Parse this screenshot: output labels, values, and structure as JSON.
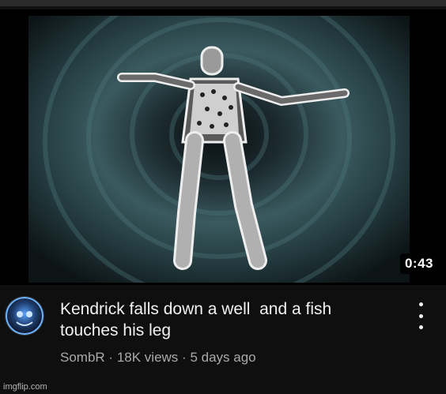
{
  "video": {
    "duration": "0:43",
    "title": "Kendrick falls down a well  and a fish\ntouches his leg",
    "channel": "SombR",
    "views": "18K views",
    "age": "5 days ago",
    "separator": "·"
  },
  "watermark": "imgflip.com",
  "icons": {
    "menu": "kebab-vertical-icon",
    "avatar": "channel-avatar"
  },
  "colors": {
    "background": "#0f0f0f",
    "title": "#f1f1f1",
    "secondary": "#aaaaaa"
  }
}
